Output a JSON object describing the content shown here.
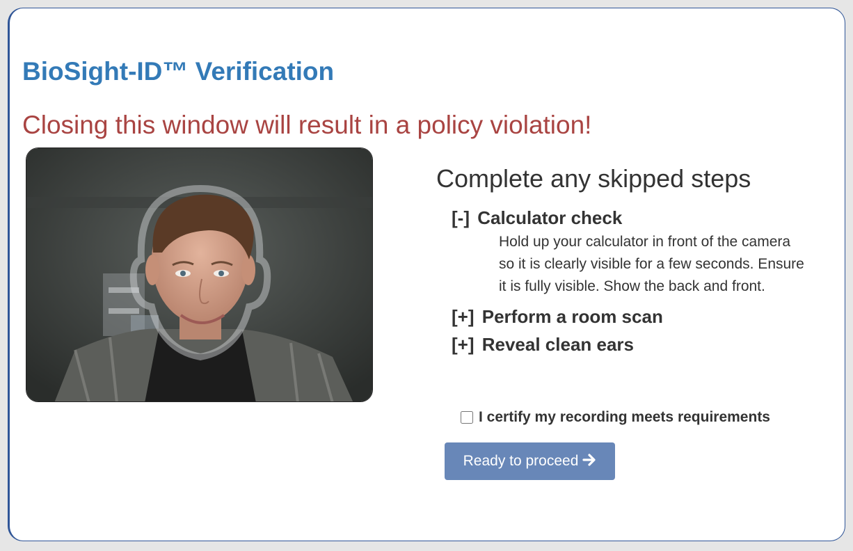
{
  "header": {
    "title": "BioSight-ID™ Verification",
    "warning": "Closing this window will result in a policy violation!"
  },
  "camera": {
    "feed": "webcam-video-feed",
    "overlay": "face-outline-guide"
  },
  "steps": {
    "heading": "Complete any skipped steps",
    "items": [
      {
        "toggle": "[-]",
        "label": "Calculator check",
        "expanded": true,
        "description": "Hold up your calculator in front of the camera so it is clearly visible for a few seconds. Ensure it is fully visible. Show the back and front."
      },
      {
        "toggle": "[+]",
        "label": "Perform a room scan",
        "expanded": false
      },
      {
        "toggle": "[+]",
        "label": "Reveal clean ears",
        "expanded": false
      }
    ]
  },
  "certify": {
    "label": "I certify my recording meets requirements",
    "checked": false
  },
  "proceed": {
    "label": "Ready to proceed",
    "icon": "arrow-right-icon"
  },
  "colors": {
    "title": "#337ab7",
    "warning": "#a94442",
    "button": "#6887b8",
    "border": "#2f5597"
  }
}
